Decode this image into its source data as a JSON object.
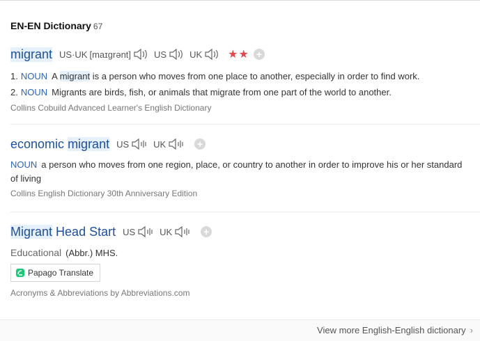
{
  "header": {
    "title": "EN-EN Dictionary",
    "count": "67"
  },
  "entry1": {
    "headword": "migrant",
    "pron_us_uk_label": "US·UK",
    "phonetic": "[maɪgrənt]",
    "us_label": "US",
    "uk_label": "UK",
    "stars": "★★",
    "defs": [
      {
        "num": "1.",
        "pos": "NOUN",
        "pre": "A",
        "word": "migrant",
        "text": "is a person who moves from one place to another, especially in order to find work."
      },
      {
        "num": "2.",
        "pos": "NOUN",
        "text": "Migrants are birds, fish, or animals that migrate from one part of the world to another."
      }
    ],
    "source": "Collins Cobuild Advanced Learner's English Dictionary"
  },
  "entry2": {
    "headword_part1": "economic",
    "headword_part2": "migrant",
    "us_label": "US",
    "uk_label": "UK",
    "def": {
      "pos": "NOUN",
      "text": "a person who moves from one region, place, or country to another in order to improve his or her standard of living"
    },
    "source": "Collins English Dictionary 30th Anniversary Edition"
  },
  "entry3": {
    "headword_part1": "Migrant",
    "headword_part2": "Head Start",
    "us_label": "US",
    "uk_label": "UK",
    "category": "Educational",
    "abbr": "(Abbr.) MHS.",
    "papago_label": "Papago Translate",
    "source": "Acronyms & Abbreviations by Abbreviations.com"
  },
  "footer": {
    "more_label": "View more English-English dictionary",
    "chevron": "›"
  },
  "icons": {
    "speaker_icon": "speaker-icon",
    "add_icon": "plus-icon",
    "papago_icon": "papago-logo-icon"
  },
  "colors": {
    "headword": "#1e4f9e",
    "pos": "#2b63b8",
    "stars": "#e2474b",
    "highlight": "#e6f0fb"
  }
}
